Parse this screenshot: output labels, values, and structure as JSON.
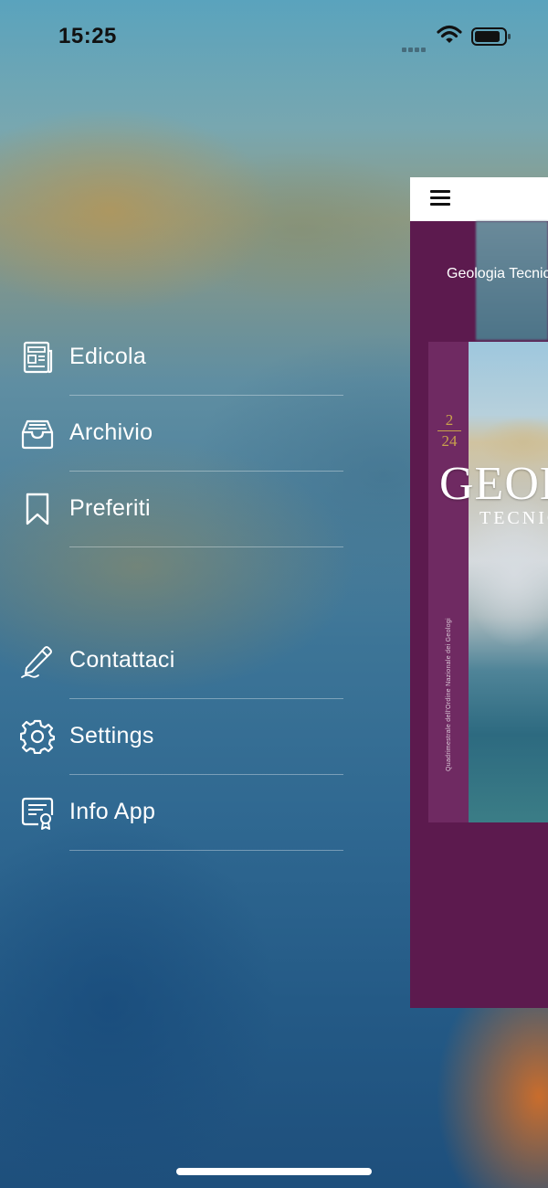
{
  "status_bar": {
    "time": "15:25",
    "icons": [
      "signal-icon",
      "wifi-icon",
      "battery-icon"
    ]
  },
  "menu": {
    "items": [
      {
        "label": "Edicola",
        "icon": "newspaper-icon"
      },
      {
        "label": "Archivio",
        "icon": "archive-tray-icon"
      },
      {
        "label": "Preferiti",
        "icon": "bookmark-icon"
      },
      {
        "label": "Contattaci",
        "icon": "pencil-icon"
      },
      {
        "label": "Settings",
        "icon": "gear-icon"
      },
      {
        "label": "Info App",
        "icon": "certificate-icon"
      }
    ]
  },
  "preview": {
    "nav_icon": "hamburger-icon",
    "title": "Geologia Tecnica",
    "cover": {
      "issue_number": "2",
      "issue_year": "24",
      "masthead": "GEOLOGIA",
      "subhead": "TECNICA",
      "spine_text": "Quadrimestrale dell'Ordine Nazionale dei Geologi"
    }
  },
  "colors": {
    "menu_text": "#ffffff",
    "cover_purple": "#5c1a4e",
    "cover_gold": "#c9a24c"
  }
}
